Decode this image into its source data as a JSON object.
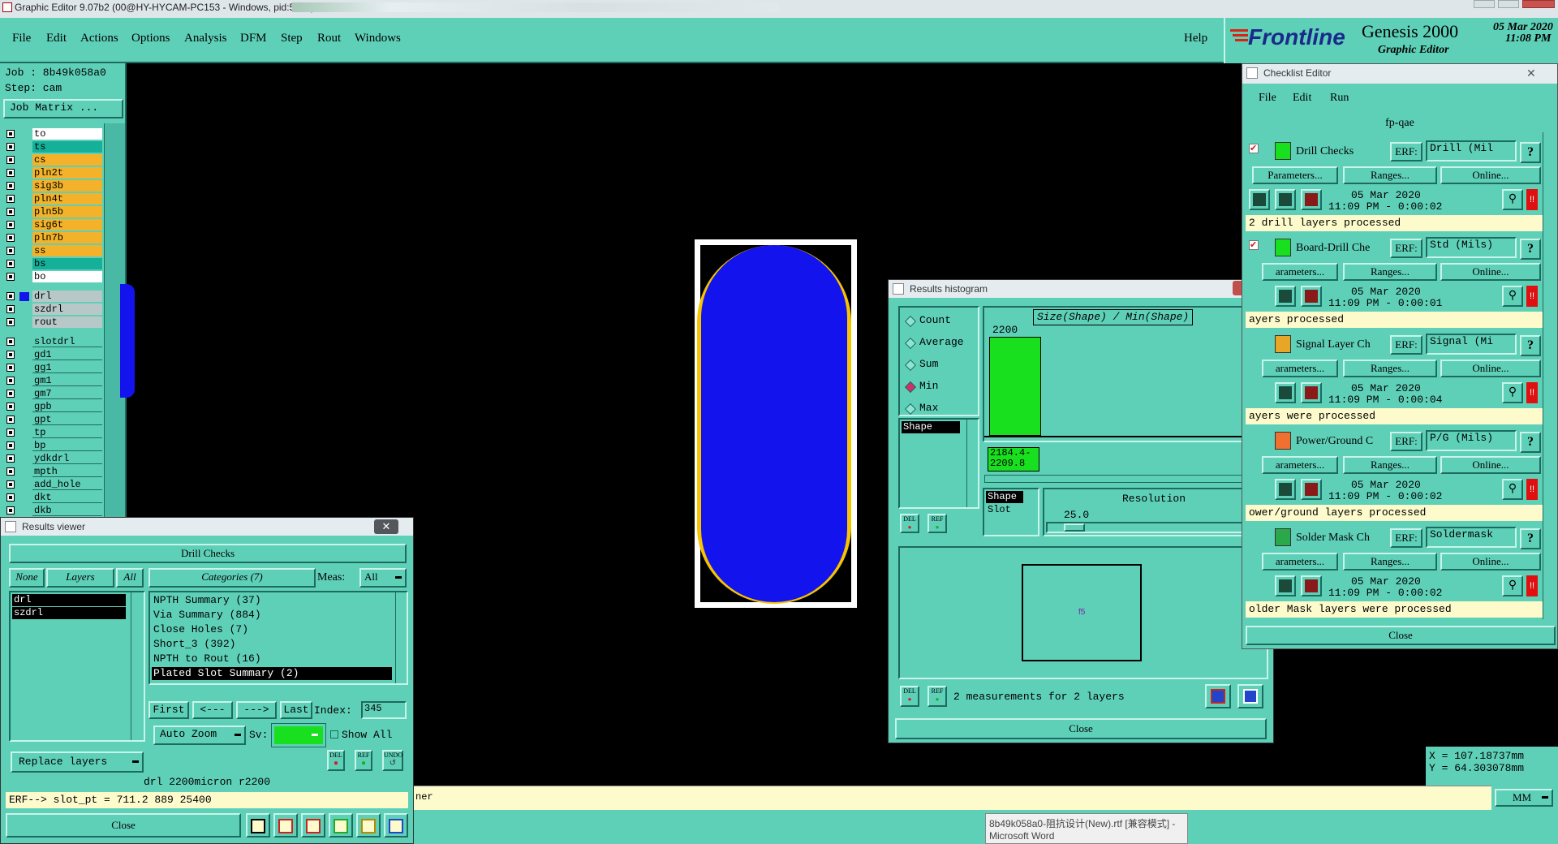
{
  "window_title": "Graphic Editor 9.07b2 (00@HY-HYCAM-PC153 - Windows, pid:5788)",
  "menu": [
    "File",
    "Edit",
    "Actions",
    "Options",
    "Analysis",
    "DFM",
    "Step",
    "Rout",
    "Windows"
  ],
  "help": "Help",
  "logo": {
    "brand": "Frontline",
    "product": "Genesis 2000",
    "subtitle": "Graphic Editor",
    "date": "05 Mar 2020",
    "time": "11:08 PM"
  },
  "job": {
    "job_line": "Job : 8b49k058a0",
    "step_line": "Step: cam",
    "matrix_button": "Job Matrix ..."
  },
  "layers_board": [
    {
      "name": "to",
      "color": "#ffffff"
    },
    {
      "name": "ts",
      "color": "#14b09a"
    },
    {
      "name": "cs",
      "color": "#f3b229"
    },
    {
      "name": "pln2t",
      "color": "#f3b229"
    },
    {
      "name": "sig3b",
      "color": "#f3b229"
    },
    {
      "name": "pln4t",
      "color": "#f3b229"
    },
    {
      "name": "pln5b",
      "color": "#f3b229"
    },
    {
      "name": "sig6t",
      "color": "#f3b229"
    },
    {
      "name": "pln7b",
      "color": "#f3b229"
    },
    {
      "name": "ss",
      "color": "#f3b229"
    },
    {
      "name": "bs",
      "color": "#14b09a"
    },
    {
      "name": "bo",
      "color": "#ffffff"
    }
  ],
  "layers_drill": [
    {
      "name": "drl",
      "color": "#b8c8c8"
    },
    {
      "name": "szdrl",
      "color": "#b8c8c8"
    },
    {
      "name": "rout",
      "color": "#b8c8c8"
    }
  ],
  "layers_misc": [
    "slotdrl",
    "gd1",
    "gg1",
    "gm1",
    "gm7",
    "gpb",
    "gpt",
    "tp",
    "bp",
    "ydkdrl",
    "mpth",
    "add_hole",
    "dkt",
    "dkb"
  ],
  "coords": {
    "x": "X = 107.18737mm",
    "y": "Y = 64.303078mm"
  },
  "units": "MM",
  "status_tail": "ner",
  "taskbar_tooltip": {
    "line1": "8b49k058a0-阻抗设计(New).rtf [兼容模式] -",
    "line2": "Microsoft Word"
  },
  "results_viewer": {
    "title": "Results viewer",
    "check_name": "Drill Checks",
    "none_btn": "None",
    "layers_btn": "Layers",
    "all_btn": "All",
    "categories_btn": "Categories (7)",
    "meas_label": "Meas:",
    "meas_value": "All",
    "layers": [
      "drl",
      "szdrl"
    ],
    "categories": [
      "NPTH Summary (37)",
      "Via Summary (884)",
      "Close Holes (7)",
      "Short_3 (392)",
      "NPTH to Rout (16)",
      "Plated Slot Summary (2)"
    ],
    "first": "First",
    "prev": "<---",
    "next": "--->",
    "last": "Last",
    "index_label": "Index:",
    "index_value": "345",
    "auto_zoom": "Auto Zoom",
    "sv_label": "Sv:",
    "show_all": "Show All",
    "replace_layers": "Replace layers",
    "del": "DEL",
    "ref": "REF",
    "undo": "UNDO",
    "info_line": "drl 2200micron  r2200",
    "erf_line": "ERF--> slot_pt = 711.2 889 25400",
    "close": "Close"
  },
  "histogram": {
    "title": "Results histogram",
    "options": [
      "Count",
      "Average",
      "Sum",
      "Min",
      "Max"
    ],
    "selected_option": "Min",
    "field_list": [
      "Shape"
    ],
    "chart_title": "Size(Shape) / Min(Shape)",
    "bar_label": "2200",
    "range_label_1": "2184.4-",
    "range_label_2": "2209.8",
    "param_list": [
      "Shape",
      "Slot"
    ],
    "resolution_label": "Resolution",
    "resolution_value": "25.0",
    "del": "DEL",
    "ref": "REF",
    "measurements": "2 measurements for 2 layers",
    "preview_mark": "f5",
    "close": "Close"
  },
  "checklist": {
    "title": "Checklist Editor",
    "menu": [
      "File",
      "Edit",
      "Run"
    ],
    "name": "fp-qae",
    "erf_label": "ERF:",
    "params_btn": "Parameters...",
    "ranges_btn": "Ranges...",
    "online_btn": "Online...",
    "params_btn_cut": "arameters...",
    "checks": [
      {
        "name": "Drill Checks",
        "erf": "Drill (Mil",
        "date": "05 Mar 2020",
        "time": "11:09 PM - 0:00:02",
        "msg": "2 drill layers processed",
        "icon_color": "#19e01f"
      },
      {
        "name": "Board-Drill Che",
        "erf": "Std (Mils)",
        "date": "05 Mar 2020",
        "time": "11:09 PM - 0:00:01",
        "msg": "ayers processed",
        "icon_color": "#19e01f"
      },
      {
        "name": "Signal Layer Ch",
        "erf": "Signal (Mi",
        "date": "05 Mar 2020",
        "time": "11:09 PM - 0:00:04",
        "msg": "ayers were processed",
        "icon_color": "#e8a628"
      },
      {
        "name": "Power/Ground C",
        "erf": "P/G (Mils)",
        "date": "05 Mar 2020",
        "time": "11:09 PM - 0:00:02",
        "msg": "ower/ground layers processed",
        "icon_color": "#f07030"
      },
      {
        "name": "Solder Mask Ch",
        "erf": "Soldermask",
        "date": "05 Mar 2020",
        "time": "11:09 PM - 0:00:02",
        "msg": "older Mask layers were processed",
        "icon_color": "#2aa84a"
      }
    ],
    "close": "Close"
  }
}
